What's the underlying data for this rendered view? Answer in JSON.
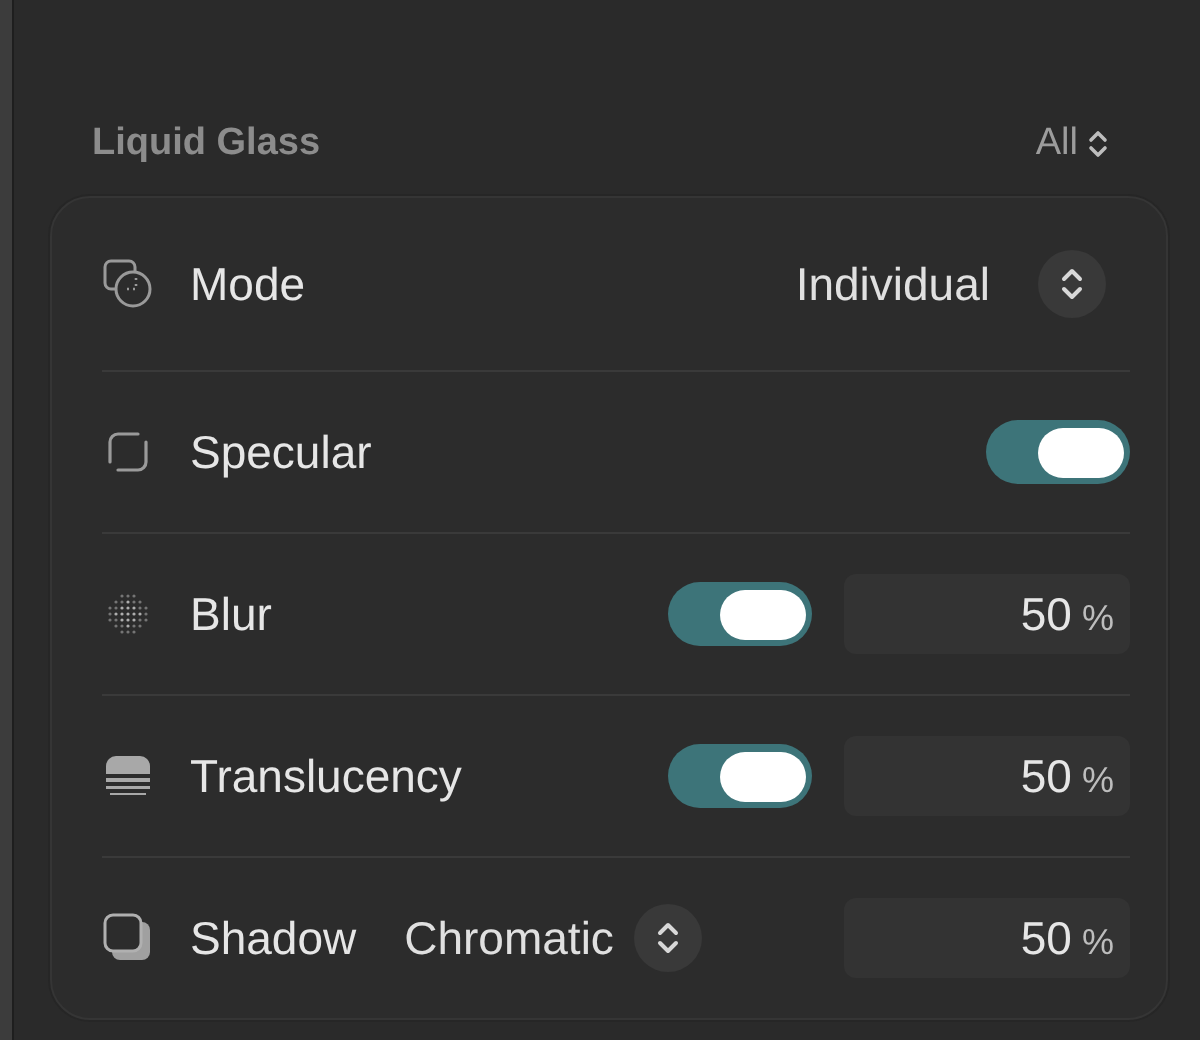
{
  "section": {
    "title": "Liquid Glass",
    "filter": "All"
  },
  "rows": [
    {
      "kind": "select",
      "label": "Mode",
      "value": "Individual"
    },
    {
      "kind": "toggle",
      "label": "Specular",
      "on": true
    },
    {
      "kind": "toggle-value",
      "label": "Blur",
      "on": true,
      "amount": "50",
      "unit": "%"
    },
    {
      "kind": "toggle-value",
      "label": "Translucency",
      "on": true,
      "amount": "50",
      "unit": "%"
    },
    {
      "kind": "select-value",
      "label": "Shadow",
      "value": "Chromatic",
      "amount": "50",
      "unit": "%"
    }
  ]
}
